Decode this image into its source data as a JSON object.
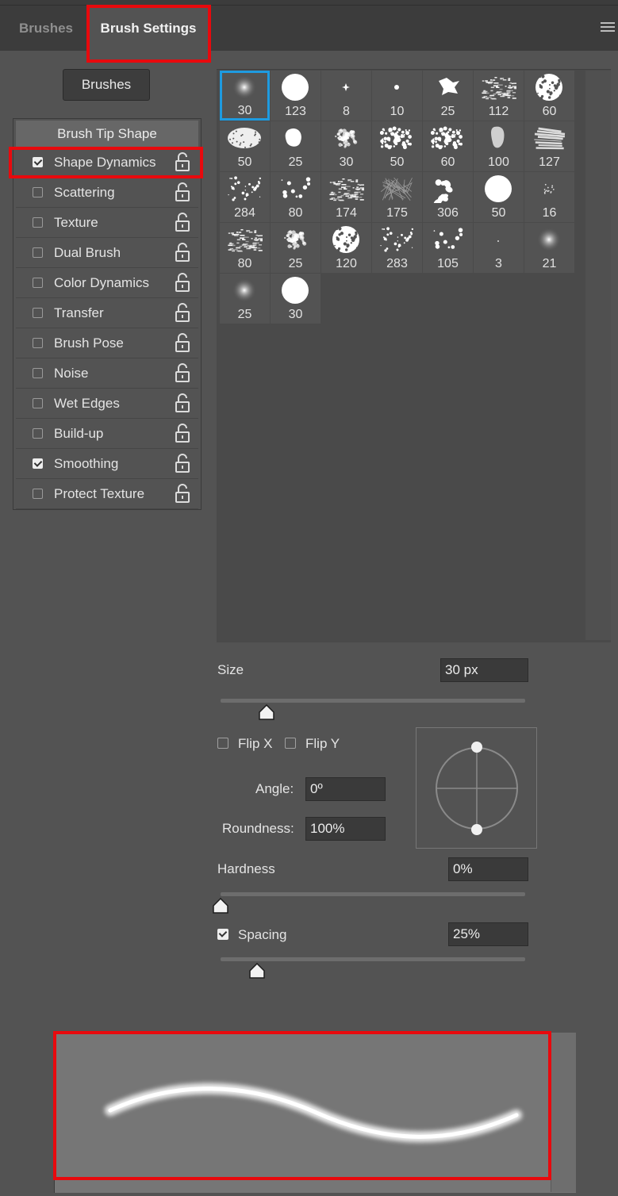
{
  "tabs": [
    {
      "label": "Brushes"
    },
    {
      "label": "Brush Settings"
    }
  ],
  "brushes_button": "Brushes",
  "options": {
    "header": "Brush Tip Shape",
    "items": [
      {
        "label": "Shape Dynamics",
        "checked": true
      },
      {
        "label": "Scattering",
        "checked": false
      },
      {
        "label": "Texture",
        "checked": false
      },
      {
        "label": "Dual Brush",
        "checked": false
      },
      {
        "label": "Color Dynamics",
        "checked": false
      },
      {
        "label": "Transfer",
        "checked": false
      },
      {
        "label": "Brush Pose",
        "checked": false
      },
      {
        "label": "Noise",
        "checked": false
      },
      {
        "label": "Wet Edges",
        "checked": false
      },
      {
        "label": "Build-up",
        "checked": false
      },
      {
        "label": "Smoothing",
        "checked": true
      },
      {
        "label": "Protect Texture",
        "checked": false
      }
    ]
  },
  "presets": [
    {
      "size": "30",
      "shape": "soft"
    },
    {
      "size": "123",
      "shape": "hard"
    },
    {
      "size": "8",
      "shape": "star"
    },
    {
      "size": "10",
      "shape": "dot"
    },
    {
      "size": "25",
      "shape": "splat"
    },
    {
      "size": "112",
      "shape": "texture"
    },
    {
      "size": "60",
      "shape": "foam"
    },
    {
      "size": "50",
      "shape": "spray"
    },
    {
      "size": "25",
      "shape": "blob"
    },
    {
      "size": "30",
      "shape": "fuzzy"
    },
    {
      "size": "50",
      "shape": "scatter"
    },
    {
      "size": "60",
      "shape": "scatter"
    },
    {
      "size": "100",
      "shape": "chalk"
    },
    {
      "size": "127",
      "shape": "stroke"
    },
    {
      "size": "284",
      "shape": "dots"
    },
    {
      "size": "80",
      "shape": "sparse"
    },
    {
      "size": "174",
      "shape": "texture"
    },
    {
      "size": "175",
      "shape": "grain"
    },
    {
      "size": "306",
      "shape": "leaves"
    },
    {
      "size": "50",
      "shape": "hard"
    },
    {
      "size": "16",
      "shape": "speck"
    },
    {
      "size": "80",
      "shape": "texture"
    },
    {
      "size": "25",
      "shape": "fuzzy"
    },
    {
      "size": "120",
      "shape": "foam"
    },
    {
      "size": "283",
      "shape": "dots"
    },
    {
      "size": "105",
      "shape": "sparse"
    },
    {
      "size": "3",
      "shape": "pixel"
    },
    {
      "size": "21",
      "shape": "soft"
    },
    {
      "size": "25",
      "shape": "soft"
    },
    {
      "size": "30",
      "shape": "hard"
    }
  ],
  "size": {
    "label": "Size",
    "value": "30 px",
    "slider": 0.15
  },
  "flip_x": {
    "label": "Flip X",
    "checked": false
  },
  "flip_y": {
    "label": "Flip Y",
    "checked": false
  },
  "angle": {
    "label": "Angle:",
    "value": "0º"
  },
  "roundness": {
    "label": "Roundness:",
    "value": "100%"
  },
  "hardness": {
    "label": "Hardness",
    "value": "0%",
    "slider": 0.0
  },
  "spacing": {
    "label": "Spacing",
    "value": "25%",
    "checked": true,
    "slider": 0.12
  },
  "colors": {
    "selection": "#1e9be0",
    "highlight": "#e8090d",
    "panel": "#535353"
  }
}
